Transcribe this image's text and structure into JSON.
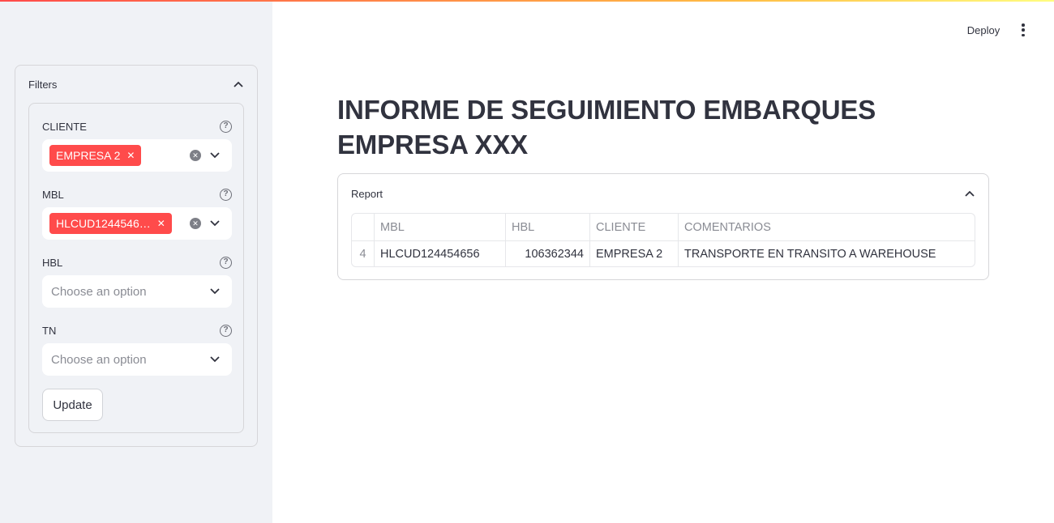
{
  "app": {
    "deploy_label": "Deploy"
  },
  "sidebar": {
    "expander_title": "Filters",
    "fields": [
      {
        "label": "CLIENTE",
        "chip": "EMPRESA 2",
        "placeholder": ""
      },
      {
        "label": "MBL",
        "chip": "HLCUD1244546…",
        "placeholder": ""
      },
      {
        "label": "HBL",
        "chip": "",
        "placeholder": "Choose an option"
      },
      {
        "label": "TN",
        "chip": "",
        "placeholder": "Choose an option"
      }
    ],
    "update_label": "Update"
  },
  "main": {
    "title": "INFORME DE SEGUIMIENTO EMBARQUES EMPRESA XXX",
    "report": {
      "title": "Report",
      "columns": [
        "MBL",
        "HBL",
        "CLIENTE",
        "COMENTARIOS"
      ],
      "rows": [
        {
          "index": "4",
          "mbl": "HLCUD124454656",
          "hbl": "106362344",
          "cliente": "EMPRESA 2",
          "comentarios": "TRANSPORTE EN TRANSITO A WAREHOUSE"
        }
      ]
    }
  },
  "colors": {
    "accent": "#ff4b4b",
    "sidebar_bg": "#f0f2f6",
    "text": "#31333f"
  }
}
